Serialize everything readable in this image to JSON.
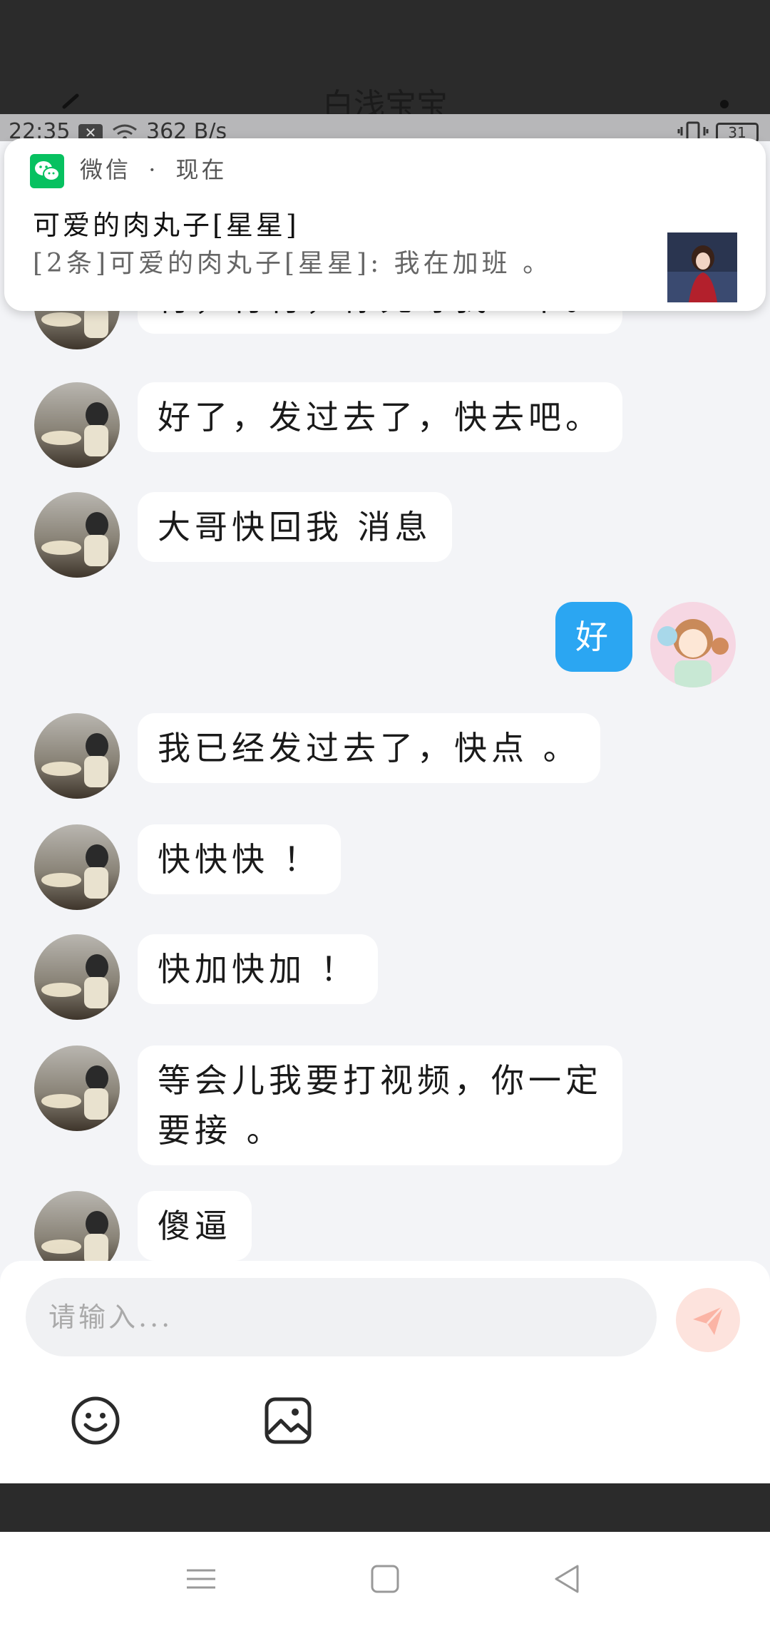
{
  "header": {
    "title": "白浅宝宝"
  },
  "status_bar": {
    "time": "22:35",
    "speed": "362 B/s",
    "battery": "31"
  },
  "notification": {
    "app_name": "微信",
    "separator": "·",
    "time": "现在",
    "title": "可爱的肉丸子[星星]",
    "body": "[2条]可爱的肉丸子[星星]: 我在加班 。"
  },
  "messages": [
    {
      "side": "left",
      "text": "行，行行，你先等我一下。"
    },
    {
      "side": "left",
      "text": "好了，发过去了，快去吧。"
    },
    {
      "side": "left",
      "text": "大哥快回我 消息"
    },
    {
      "side": "right",
      "text": "好"
    },
    {
      "side": "left",
      "text": "我已经发过去了，快点 。"
    },
    {
      "side": "left",
      "text": "快快快 ！"
    },
    {
      "side": "left",
      "text": "快加快加 ！"
    },
    {
      "side": "left",
      "text": "等会儿我要打视频，你一定\n要接 。"
    },
    {
      "side": "left",
      "text": "傻逼"
    }
  ],
  "input": {
    "placeholder": "请输入..."
  },
  "icons": {
    "send": "paper-plane-icon",
    "emoji": "smiley-icon",
    "image": "image-icon",
    "nav_menu": "menu-icon",
    "nav_home": "square-home-icon",
    "nav_back": "triangle-back-icon"
  },
  "colors": {
    "my_bubble": "#2ba6f2",
    "their_bubble": "#ffffff",
    "send_button": "#fde3dd",
    "wechat_green": "#07c160"
  }
}
